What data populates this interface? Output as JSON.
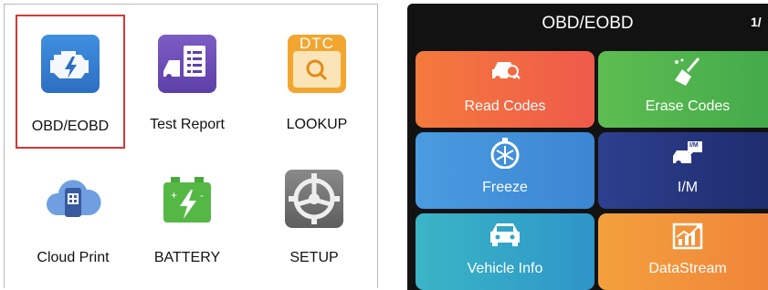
{
  "main_menu": {
    "items": [
      {
        "label": "OBD/EOBD",
        "icon": "engine-icon",
        "selected": true
      },
      {
        "label": "Test Report",
        "icon": "test-report-icon"
      },
      {
        "label": "LOOKUP",
        "icon": "dtc-lookup-icon",
        "icon_text": "DTC"
      },
      {
        "label": "Cloud Print",
        "icon": "cloud-print-icon"
      },
      {
        "label": "BATTERY",
        "icon": "battery-icon"
      },
      {
        "label": "SETUP",
        "icon": "setup-wheel-icon"
      }
    ]
  },
  "device": {
    "title": "OBD/EOBD",
    "page_indicator": "1/",
    "tiles": [
      {
        "label": "Read Codes",
        "icon": "car-search-icon",
        "color": "#f26a43"
      },
      {
        "label": "Erase Codes",
        "icon": "broom-icon",
        "color": "#4fb34f"
      },
      {
        "label": "Freeze",
        "icon": "snowflake-timer-icon",
        "color": "#4392da"
      },
      {
        "label": "I/M",
        "icon": "im-readiness-icon",
        "icon_text": "I/M",
        "color": "#26367e"
      },
      {
        "label": "Vehicle Info",
        "icon": "vehicle-info-icon",
        "color": "#33a6c7"
      },
      {
        "label": "DataStream",
        "icon": "datastream-chart-icon",
        "color": "#f2923b"
      }
    ]
  }
}
